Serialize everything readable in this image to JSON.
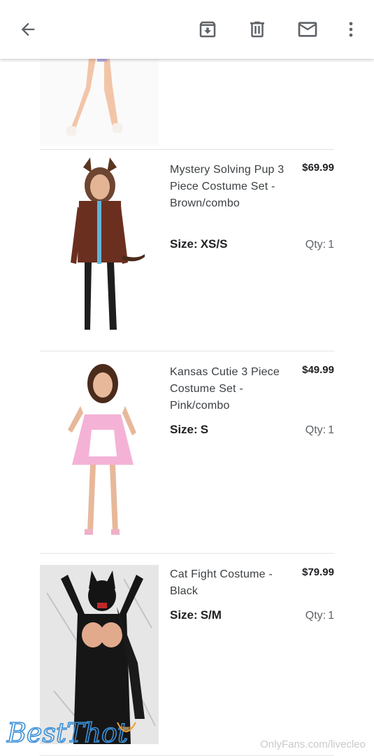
{
  "toolbar": {
    "back_icon": "arrow-left-icon",
    "archive_icon": "archive-icon",
    "delete_icon": "trash-icon",
    "mail_icon": "mail-icon",
    "more_icon": "more-vert-icon"
  },
  "labels": {
    "size_prefix": "Size:",
    "qty_prefix": "Qty:"
  },
  "items": [
    {
      "title": "Mystery Solving Pup 3 Piece Costume Set - Brown/combo",
      "price": "$69.99",
      "size": "XS/S",
      "qty": "1"
    },
    {
      "title": "Kansas Cutie 3 Piece Costume Set - Pink/combo",
      "price": "$49.99",
      "size": "S",
      "qty": "1"
    },
    {
      "title": "Cat Fight Costume - Black",
      "price": "$79.99",
      "size": "S/M",
      "qty": "1"
    }
  ],
  "watermarks": {
    "left_logo_text": "BestThot",
    "right_text": "OnlyFans.com/livecleo"
  },
  "colors": {
    "accent": "#5f6368",
    "divider": "#e4e4e4"
  }
}
